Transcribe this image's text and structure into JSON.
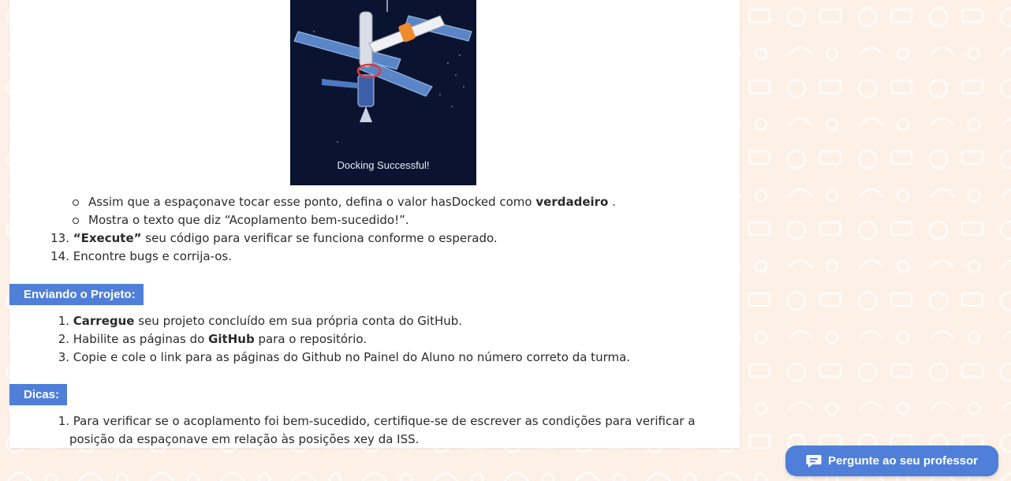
{
  "colors": {
    "accent": "#4f7fd8",
    "background": "#fdf0e6",
    "card": "#ffffff"
  },
  "image": {
    "caption": "Docking Successful!"
  },
  "sub_items": [
    {
      "text": "Assim que a espaçonave tocar esse ponto, defina o valor hasDocked como ",
      "bold": "verdadeiro",
      "after": " ."
    },
    {
      "text": "Mostra o texto que diz “Acoplamento bem-sucedido!”."
    }
  ],
  "steps": [
    {
      "num": "13.",
      "bold": "“Execute”",
      "text": " seu código para verificar se funciona conforme o esperado."
    },
    {
      "num": "14.",
      "text": "Encontre bugs e corrija-os."
    }
  ],
  "submit": {
    "heading": "Enviando o Projeto:",
    "items": [
      {
        "num": "1.",
        "bold": "Carregue",
        "text": " seu projeto concluído em sua própria conta do GitHub."
      },
      {
        "num": "2.",
        "pre": "Habilite as páginas do ",
        "bold": "GitHub",
        "text": " para o repositório."
      },
      {
        "num": "3.",
        "text": "Copie e cole o link para as páginas do Github no Painel do Aluno no número correto da turma."
      }
    ]
  },
  "tips": {
    "heading": "Dicas:",
    "items": [
      {
        "num": "1.",
        "line1": "Para verificar se o acoplamento foi bem-sucedido, certifique-se de escrever as condições para verificar a",
        "line2": "posição da espaçonave em relação às posições xey da ISS."
      }
    ]
  },
  "ask_button": {
    "label": "Pergunte ao seu professor",
    "icon": "chat-icon"
  }
}
